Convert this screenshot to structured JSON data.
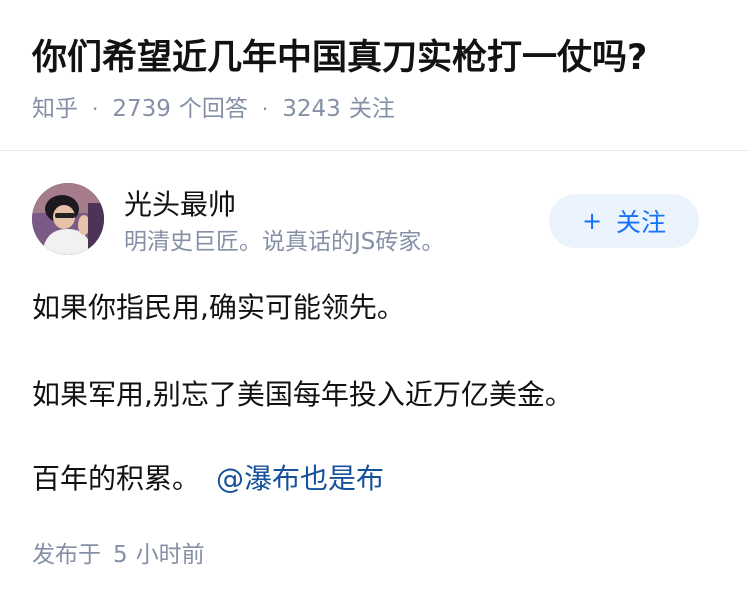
{
  "question": {
    "title": "你们希望近几年中国真刀实枪打一仗吗?",
    "source": "知乎",
    "answer_count": "2739",
    "answer_label": "个回答",
    "follow_count": "3243",
    "follow_label": "关注"
  },
  "author": {
    "name": "光头最帅",
    "bio": "明清史巨匠。说真话的JS砖家。",
    "follow_button": "关注",
    "follow_icon": "plus-icon"
  },
  "answer": {
    "paragraphs": [
      "如果你指民用,确实可能领先。",
      "如果军用,别忘了美国每年投入近万亿美金。",
      "百年的积累。"
    ],
    "mention": "@瀑布也是布"
  },
  "footer": {
    "publish_prefix": "发布于",
    "publish_num": "5",
    "publish_suffix": "小时前"
  },
  "colors": {
    "text": "#121212",
    "meta": "#8590a6",
    "link": "#175199",
    "button_bg": "#ebf3fc",
    "button_text": "#1772f6"
  }
}
